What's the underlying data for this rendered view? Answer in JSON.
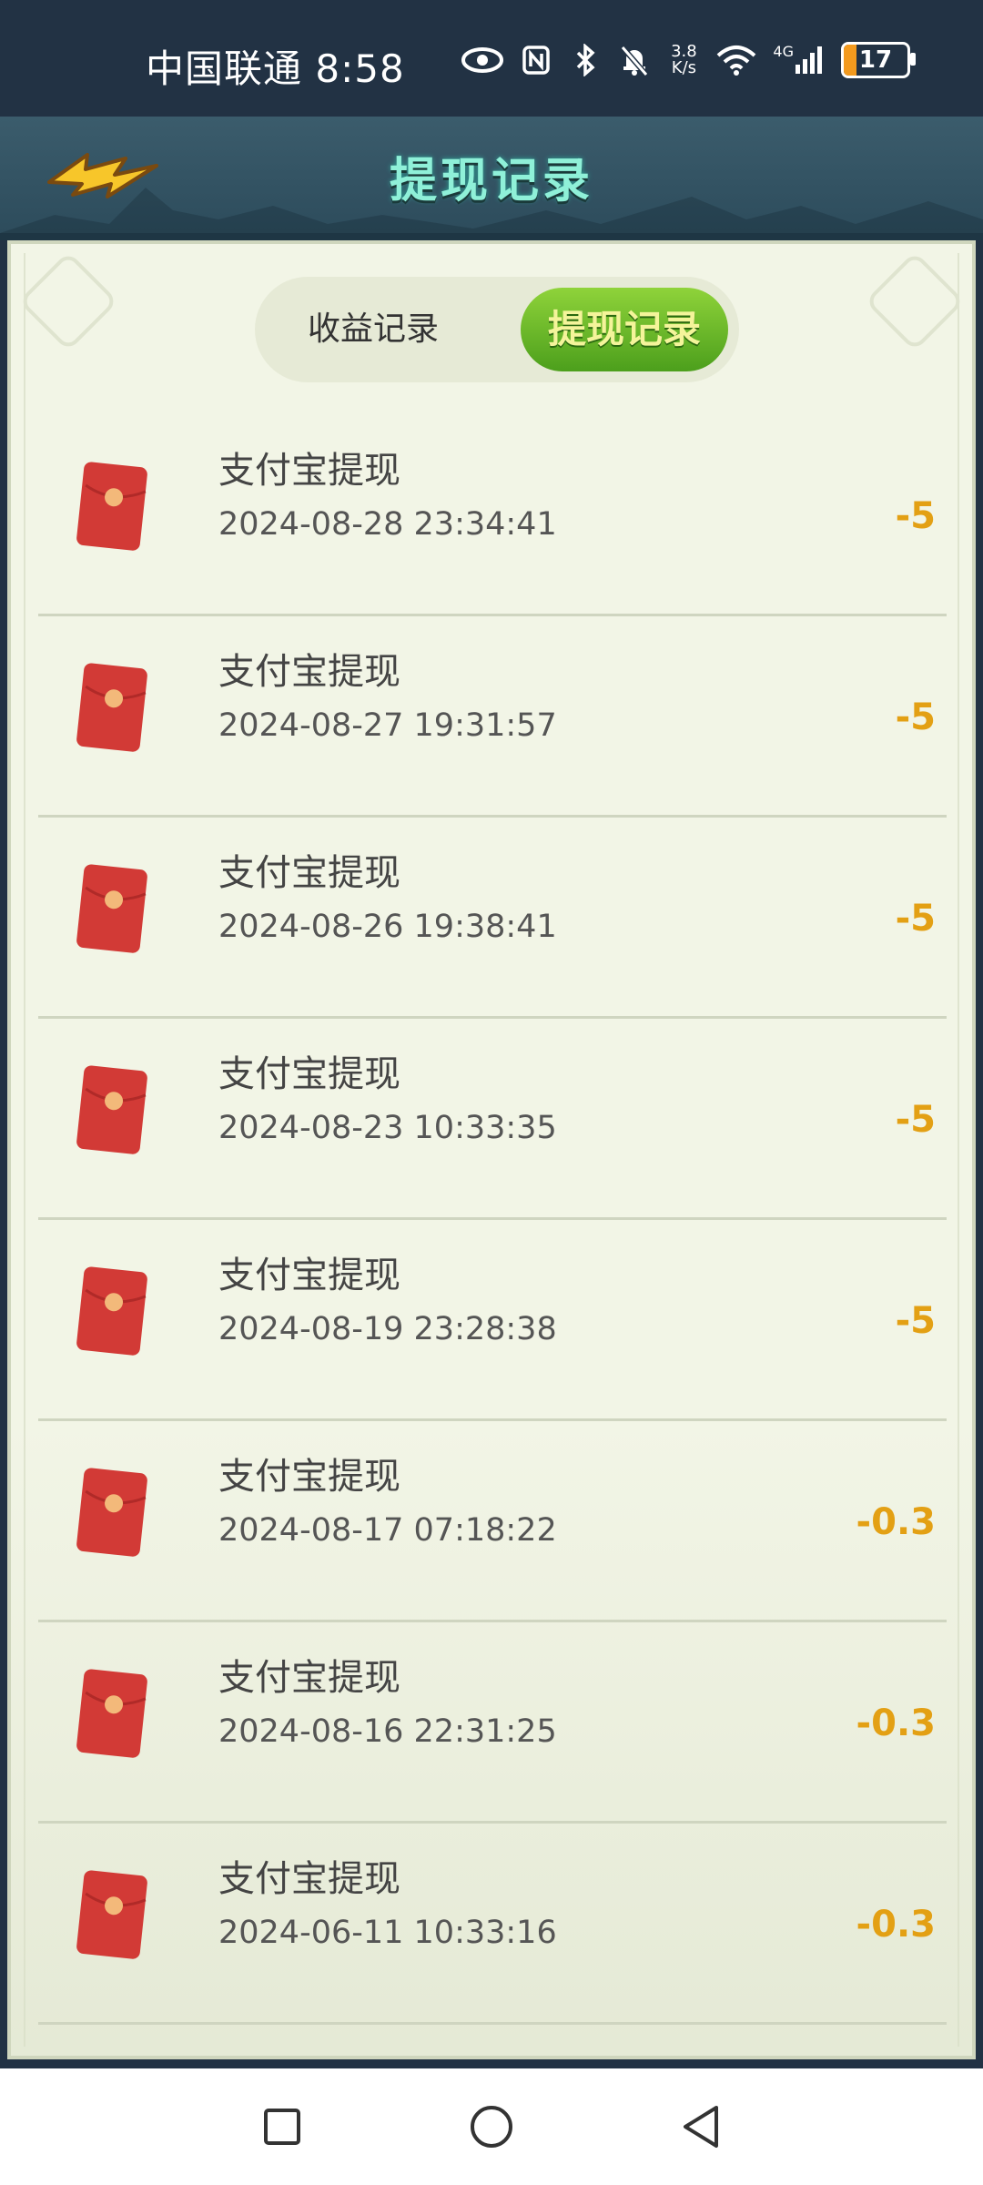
{
  "status_bar": {
    "carrier": "中国联通",
    "time": "8:58",
    "net_speed_top": "3.8",
    "net_speed_bottom": "K/s",
    "network": "4G",
    "battery": "17"
  },
  "header": {
    "title": "提现记录"
  },
  "tabs": {
    "income_label": "收益记录",
    "withdraw_label": "提现记录",
    "active": "withdraw"
  },
  "records": [
    {
      "title": "支付宝提现",
      "datetime": "2024-08-28 23:34:41",
      "amount": "-5"
    },
    {
      "title": "支付宝提现",
      "datetime": "2024-08-27 19:31:57",
      "amount": "-5"
    },
    {
      "title": "支付宝提现",
      "datetime": "2024-08-26 19:38:41",
      "amount": "-5"
    },
    {
      "title": "支付宝提现",
      "datetime": "2024-08-23 10:33:35",
      "amount": "-5"
    },
    {
      "title": "支付宝提现",
      "datetime": "2024-08-19 23:28:38",
      "amount": "-5"
    },
    {
      "title": "支付宝提现",
      "datetime": "2024-08-17 07:18:22",
      "amount": "-0.3"
    },
    {
      "title": "支付宝提现",
      "datetime": "2024-08-16 22:31:25",
      "amount": "-0.3"
    },
    {
      "title": "支付宝提现",
      "datetime": "2024-06-11 10:33:16",
      "amount": "-0.3"
    }
  ],
  "icons": {
    "back": "lightning-arrow-back-icon",
    "record": "red-envelope-icon",
    "nav_recent": "square-icon",
    "nav_home": "circle-icon",
    "nav_back": "triangle-back-icon"
  },
  "colors": {
    "amount": "#e3a014",
    "active_tab": "#5aaa22",
    "header_title": "#8ff0d8"
  }
}
